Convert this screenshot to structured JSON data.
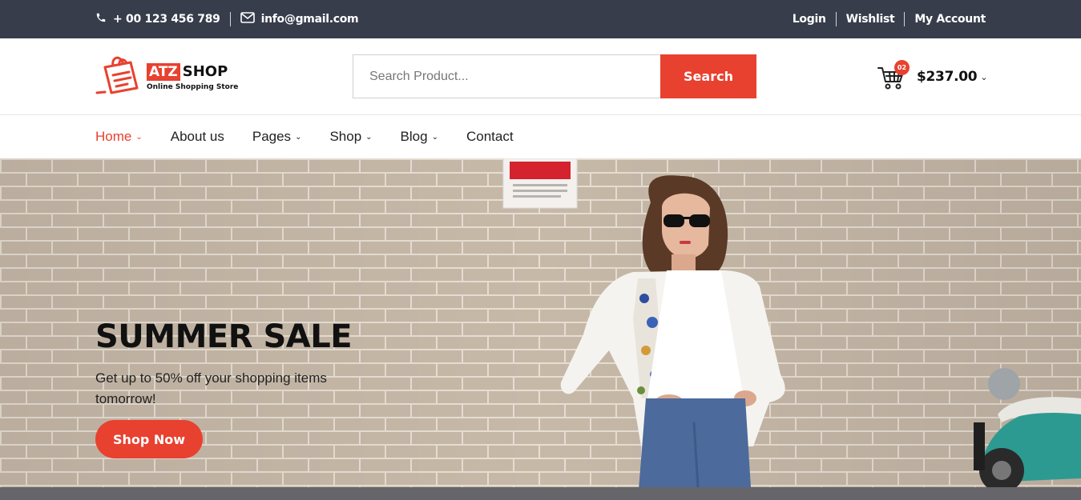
{
  "topbar": {
    "phone": "+ 00 123 456 789",
    "email": "info@gmail.com",
    "links": [
      "Login",
      "Wishlist",
      "My Account"
    ]
  },
  "logo": {
    "atz": "ATZ",
    "shop": "SHOP",
    "tagline": "Online Shopping Store"
  },
  "search": {
    "placeholder": "Search Product...",
    "button_label": "Search"
  },
  "cart": {
    "count": "02",
    "total": "$237.00"
  },
  "nav": {
    "items": [
      {
        "label": "Home",
        "dropdown": true,
        "active": true
      },
      {
        "label": "About us",
        "dropdown": false,
        "active": false
      },
      {
        "label": "Pages",
        "dropdown": true,
        "active": false
      },
      {
        "label": "Shop",
        "dropdown": true,
        "active": false
      },
      {
        "label": "Blog",
        "dropdown": true,
        "active": false
      },
      {
        "label": "Contact",
        "dropdown": false,
        "active": false
      }
    ]
  },
  "hero": {
    "title": "SUMMER SALE",
    "subtitle": "Get up to 50% off your shopping items tomorrow!",
    "button_label": "Shop Now"
  },
  "colors": {
    "accent": "#e8412f",
    "topbar_bg": "#373d4b",
    "brick_wall": "#c3b5a4"
  }
}
